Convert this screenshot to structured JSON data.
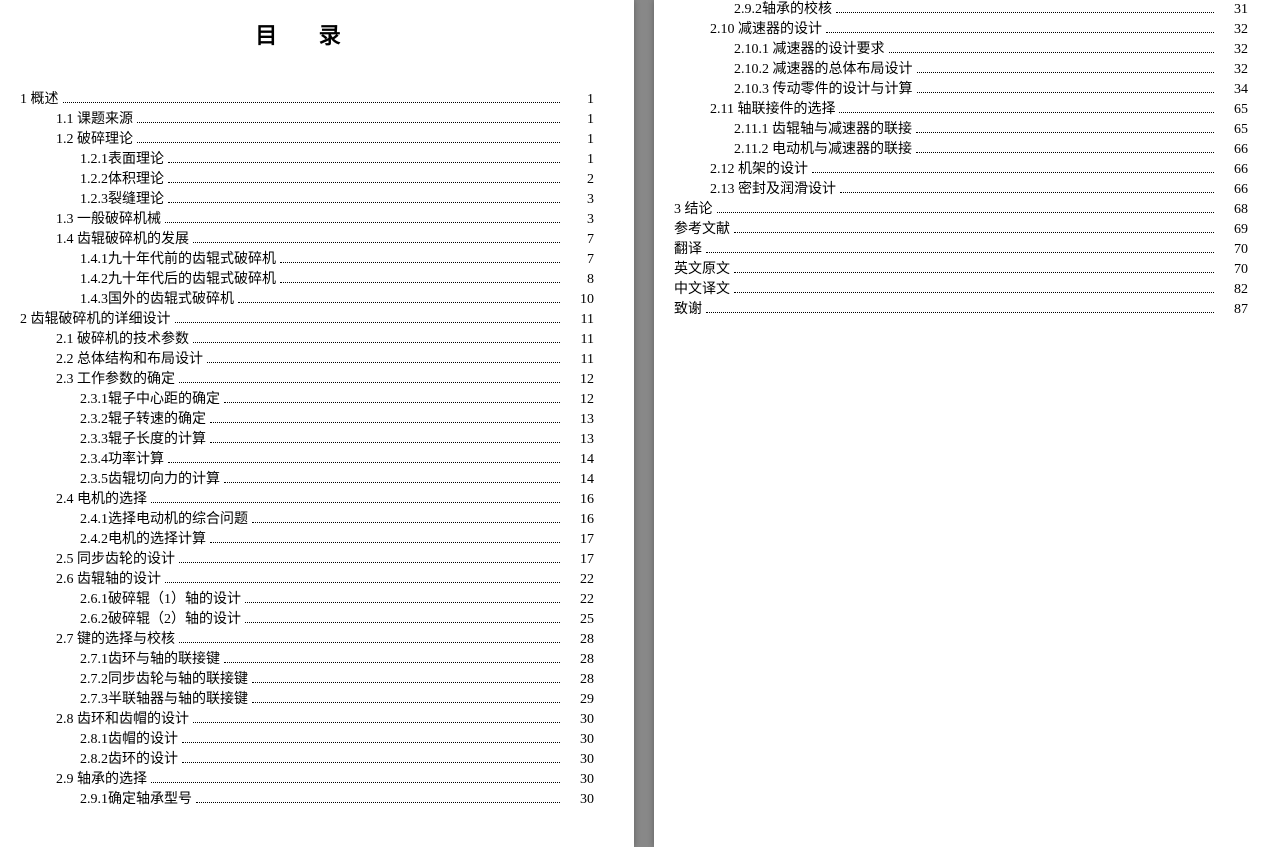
{
  "title": "目  录",
  "left": [
    {
      "i": 0,
      "t": "1 概述",
      "p": "1"
    },
    {
      "i": 1,
      "t": "1.1 课题来源",
      "p": "1"
    },
    {
      "i": 1,
      "t": "1.2 破碎理论",
      "p": "1"
    },
    {
      "i": 2,
      "t": "1.2.1表面理论",
      "p": "1"
    },
    {
      "i": 2,
      "t": "1.2.2体积理论",
      "p": "2"
    },
    {
      "i": 2,
      "t": "1.2.3裂缝理论",
      "p": "3"
    },
    {
      "i": 1,
      "t": "1.3 一般破碎机械",
      "p": "3"
    },
    {
      "i": 1,
      "t": "1.4 齿辊破碎机的发展",
      "p": "7"
    },
    {
      "i": 2,
      "t": "1.4.1九十年代前的齿辊式破碎机",
      "p": "7"
    },
    {
      "i": 2,
      "t": "1.4.2九十年代后的齿辊式破碎机",
      "p": "8"
    },
    {
      "i": 2,
      "t": "1.4.3国外的齿辊式破碎机",
      "p": "10"
    },
    {
      "i": 0,
      "t": "2 齿辊破碎机的详细设计",
      "p": "11"
    },
    {
      "i": 1,
      "t": "2.1 破碎机的技术参数",
      "p": "11"
    },
    {
      "i": 1,
      "t": "2.2 总体结构和布局设计",
      "p": "11"
    },
    {
      "i": 1,
      "t": "2.3 工作参数的确定",
      "p": "12"
    },
    {
      "i": 2,
      "t": "2.3.1辊子中心距的确定",
      "p": "12"
    },
    {
      "i": 2,
      "t": "2.3.2辊子转速的确定",
      "p": "13"
    },
    {
      "i": 2,
      "t": "2.3.3辊子长度的计算",
      "p": "13"
    },
    {
      "i": 2,
      "t": "2.3.4功率计算",
      "p": "14"
    },
    {
      "i": 2,
      "t": "2.3.5齿辊切向力的计算",
      "p": "14"
    },
    {
      "i": 1,
      "t": "2.4 电机的选择",
      "p": "16"
    },
    {
      "i": 2,
      "t": "2.4.1选择电动机的综合问题",
      "p": "16"
    },
    {
      "i": 2,
      "t": "2.4.2电机的选择计算",
      "p": "17"
    },
    {
      "i": 1,
      "t": "2.5 同步齿轮的设计",
      "p": "17"
    },
    {
      "i": 1,
      "t": "2.6 齿辊轴的设计",
      "p": "22"
    },
    {
      "i": 2,
      "t": "2.6.1破碎辊（1）轴的设计",
      "p": "22"
    },
    {
      "i": 2,
      "t": "2.6.2破碎辊（2）轴的设计",
      "p": "25"
    },
    {
      "i": 1,
      "t": "2.7 键的选择与校核",
      "p": "28"
    },
    {
      "i": 2,
      "t": "2.7.1齿环与轴的联接键",
      "p": "28"
    },
    {
      "i": 2,
      "t": "2.7.2同步齿轮与轴的联接键",
      "p": "28"
    },
    {
      "i": 2,
      "t": "2.7.3半联轴器与轴的联接键",
      "p": "29"
    },
    {
      "i": 1,
      "t": "2.8 齿环和齿帽的设计",
      "p": "30"
    },
    {
      "i": 2,
      "t": "2.8.1齿帽的设计",
      "p": "30"
    },
    {
      "i": 2,
      "t": "2.8.2齿环的设计",
      "p": "30"
    },
    {
      "i": 1,
      "t": "2.9 轴承的选择",
      "p": "30"
    },
    {
      "i": 2,
      "t": "2.9.1确定轴承型号",
      "p": "30"
    }
  ],
  "right": [
    {
      "i": 2,
      "t": "2.9.2轴承的校核",
      "p": "31"
    },
    {
      "i": 1,
      "t": "2.10 减速器的设计",
      "p": "32"
    },
    {
      "i": 2,
      "t": "2.10.1 减速器的设计要求",
      "p": "32"
    },
    {
      "i": 2,
      "t": "2.10.2 减速器的总体布局设计",
      "p": "32"
    },
    {
      "i": 2,
      "t": "2.10.3 传动零件的设计与计算",
      "p": "34"
    },
    {
      "i": 1,
      "t": "2.11 轴联接件的选择",
      "p": "65"
    },
    {
      "i": 2,
      "t": "2.11.1 齿辊轴与减速器的联接",
      "p": "65"
    },
    {
      "i": 2,
      "t": "2.11.2 电动机与减速器的联接",
      "p": "66"
    },
    {
      "i": 1,
      "t": "2.12 机架的设计",
      "p": "66"
    },
    {
      "i": 1,
      "t": "2.13 密封及润滑设计",
      "p": "66"
    },
    {
      "i": 0,
      "t": "3 结论",
      "p": "68"
    },
    {
      "i": 0,
      "t": "参考文献",
      "p": "69"
    },
    {
      "i": 0,
      "t": "翻译",
      "p": "70"
    },
    {
      "i": 0,
      "t": "英文原文",
      "p": "70"
    },
    {
      "i": 0,
      "t": "中文译文",
      "p": "82"
    },
    {
      "i": 0,
      "t": "致谢",
      "p": "87"
    }
  ]
}
